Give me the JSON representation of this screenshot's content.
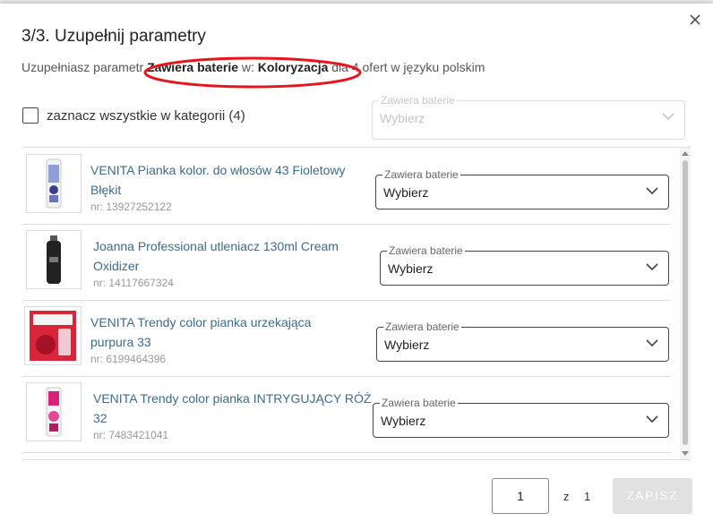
{
  "dialog": {
    "title": "3/3. Uzupełnij parametry",
    "subtitle": {
      "prefix": "Uzupełniasz parametr ",
      "param": "Zawiera baterie",
      "mid": " w: ",
      "category": "Koloryzacja",
      "suffix": " dla 4 ofert w języku polskim"
    },
    "close_icon": "close-icon"
  },
  "select_all": {
    "label": "zaznacz wszystkie w kategorii (4)",
    "checked": false,
    "bulk_field": {
      "legend": "Zawiera baterie",
      "value": "Wybierz",
      "disabled": true
    }
  },
  "products": [
    {
      "name_line1": "VENITA Pianka kolor. do włosów 43 Fioletowy",
      "name_line2": "Błękit",
      "nr": "nr: 13927252122",
      "field_legend": "Zawiera baterie",
      "field_value": "Wybierz"
    },
    {
      "name_line1": "Joanna Professional utleniacz 130ml Cream",
      "name_line2": "Oxidizer",
      "nr": "nr: 14117667324",
      "field_legend": "Zawiera baterie",
      "field_value": "Wybierz"
    },
    {
      "name_line1": "VENITA Trendy color pianka urzekająca",
      "name_line2": "purpura 33",
      "nr": "nr: 6199464396",
      "field_legend": "Zawiera baterie",
      "field_value": "Wybierz"
    },
    {
      "name_line1": "VENITA Trendy color pianka INTRYGUJĄCY RÓŻ",
      "name_line2": "32",
      "nr": "nr: 7483421041",
      "field_legend": "Zawiera baterie",
      "field_value": "Wybierz"
    }
  ],
  "pagination": {
    "current": "1",
    "of_label": "z",
    "total": "1"
  },
  "save_label": "ZAPISZ",
  "colors": {
    "link": "#3d6b8a",
    "annotation": "#e8141c",
    "save_disabled": "#e1e1e1"
  }
}
